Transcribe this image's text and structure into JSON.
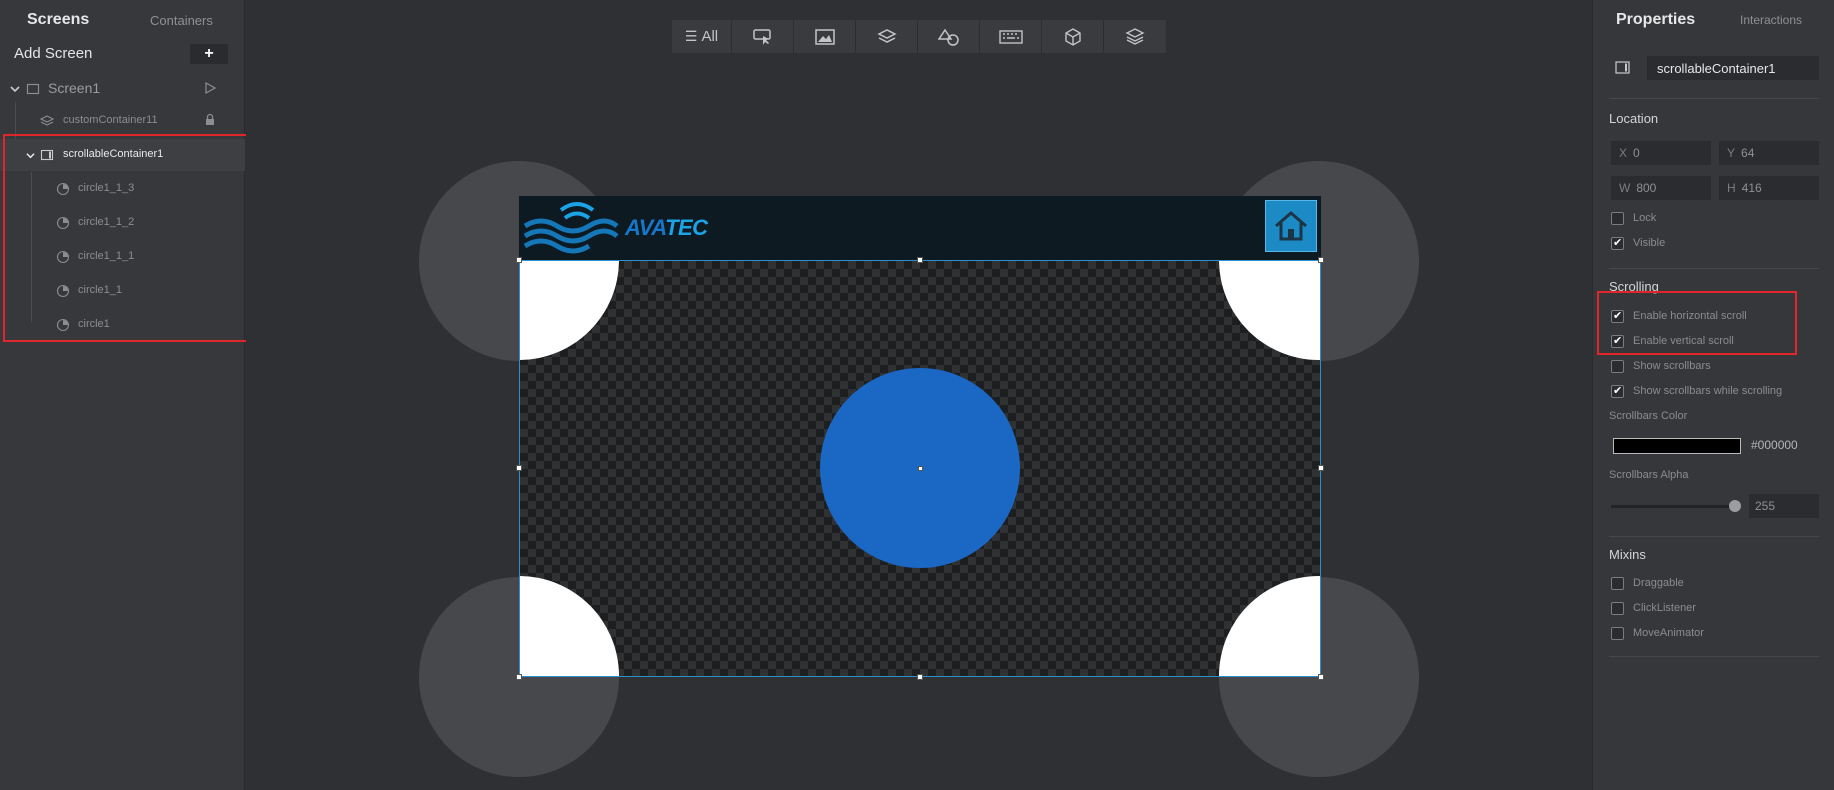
{
  "left_panel": {
    "tabs": [
      "Screens",
      "Containers"
    ],
    "add_screen_label": "Add Screen",
    "add_button": "+",
    "screen_name": "Screen1",
    "tree": [
      {
        "label": "customContainer11",
        "locked": true
      },
      {
        "label": "scrollableContainer1",
        "selected": true
      },
      {
        "label": "circle1_1_3"
      },
      {
        "label": "circle1_1_2"
      },
      {
        "label": "circle1_1_1"
      },
      {
        "label": "circle1_1"
      },
      {
        "label": "circle1"
      }
    ]
  },
  "toolbar": {
    "all_label": "All",
    "buttons": [
      "interaction-icon",
      "image-icon",
      "layers-icon",
      "shapes-icon",
      "keyboard-icon",
      "cube-icon",
      "stack-icon"
    ]
  },
  "device": {
    "brand_prefix": "AVA",
    "brand_suffix": "TEC"
  },
  "right_panel": {
    "tabs": [
      "Properties",
      "Interactions"
    ],
    "name": "scrollableContainer1",
    "location_title": "Location",
    "x_label": "X",
    "x_value": "0",
    "y_label": "Y",
    "y_value": "64",
    "w_label": "W",
    "w_value": "800",
    "h_label": "H",
    "h_value": "416",
    "lock_label": "Lock",
    "visible_label": "Visible",
    "scrolling_title": "Scrolling",
    "hscroll_label": "Enable horizontal scroll",
    "vscroll_label": "Enable vertical scroll",
    "show_scrollbars_label": "Show scrollbars",
    "show_while_label": "Show scrollbars while scrolling",
    "scroll_color_title": "Scrollbars Color",
    "scroll_color_value": "#000000",
    "scroll_alpha_title": "Scrollbars Alpha",
    "scroll_alpha_value": "255",
    "mixins_title": "Mixins",
    "draggable_label": "Draggable",
    "click_listener_label": "ClickListener",
    "move_animator_label": "MoveAnimator"
  },
  "colors": {
    "highlight": "#e0252b",
    "accent_blue": "#1a67c4",
    "brand_blue": "#1aa3e6"
  }
}
